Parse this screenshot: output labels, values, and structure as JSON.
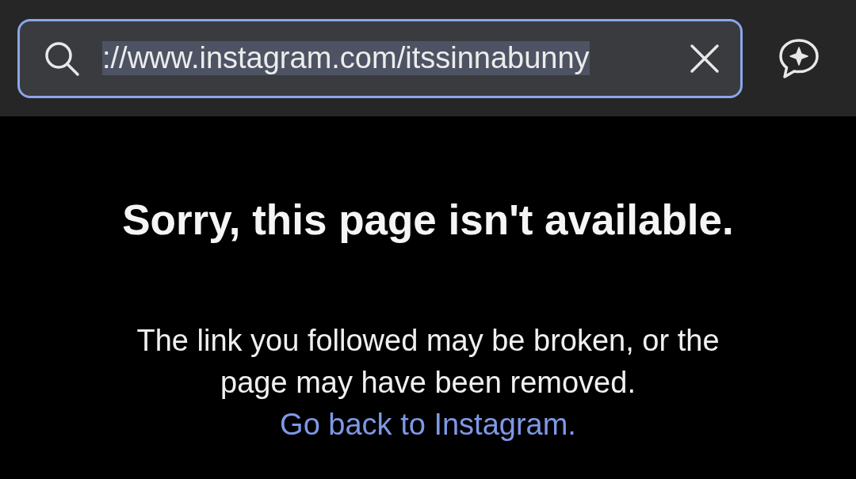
{
  "address_bar": {
    "value": "://www.instagram.com/itssinnabunny",
    "selected": true,
    "focused": true
  },
  "heading": "Sorry, this page isn't available.",
  "message": {
    "text": "The link you followed may be broken, or the page may have been removed.",
    "link": "Go back to Instagram."
  }
}
